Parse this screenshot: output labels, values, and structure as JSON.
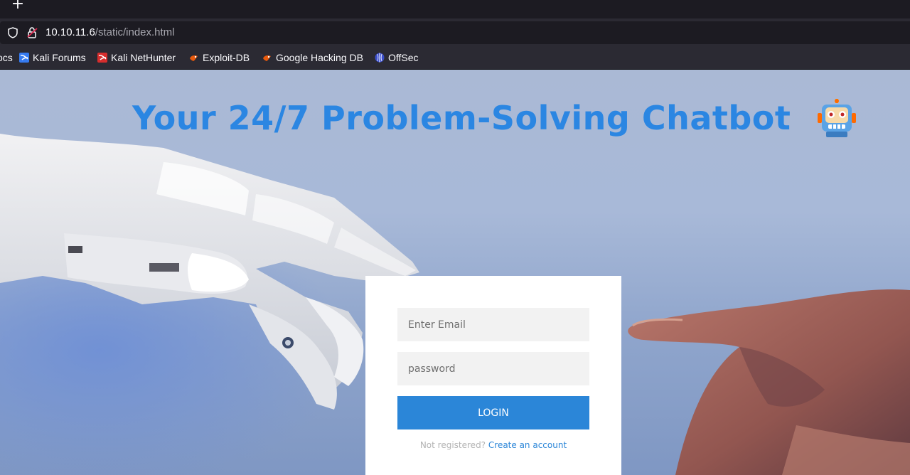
{
  "browser": {
    "new_tab_label": "+",
    "url_host": "10.10.11.6",
    "url_path": "/static/index.html"
  },
  "bookmarks": [
    {
      "label": "ocs",
      "icon": "docs-icon"
    },
    {
      "label": "Kali Forums",
      "icon": "kali-forums-icon"
    },
    {
      "label": "Kali NetHunter",
      "icon": "kali-nethunter-icon"
    },
    {
      "label": "Exploit-DB",
      "icon": "exploit-db-icon"
    },
    {
      "label": "Google Hacking DB",
      "icon": "exploit-db-icon"
    },
    {
      "label": "OffSec",
      "icon": "offsec-icon"
    }
  ],
  "page": {
    "headline": "Your 24/7 Problem-Solving Chatbot",
    "headline_icon": "robot-emoji",
    "login": {
      "email_placeholder": "Enter Email",
      "password_placeholder": "password",
      "button_label": "LOGIN",
      "signup_prompt": "Not registered?",
      "signup_link": "Create an account"
    }
  },
  "colors": {
    "accent": "#2b86d8",
    "headline": "#2b86e2",
    "browser_bg": "#2b2a33"
  }
}
